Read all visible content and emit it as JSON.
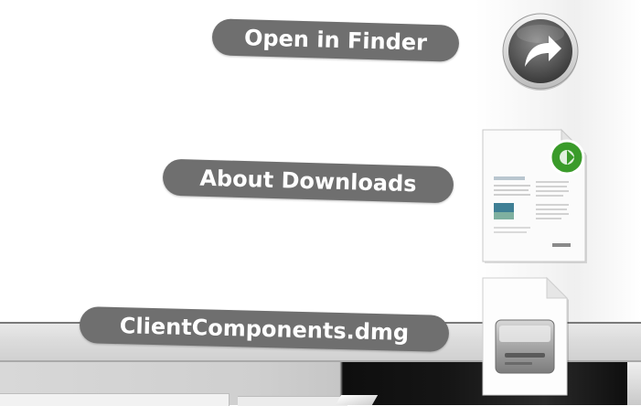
{
  "stack": {
    "items": [
      {
        "label": "Open in Finder",
        "icon": "open-in-finder-arrow-icon"
      },
      {
        "label": "About Downloads",
        "icon": "document-icon"
      },
      {
        "label": "ClientComponents.dmg",
        "icon": "disk-image-icon"
      }
    ]
  },
  "colors": {
    "pill": "#6f6f6f",
    "pill_text": "#ffffff",
    "badge_green": "#3a9b2a"
  }
}
